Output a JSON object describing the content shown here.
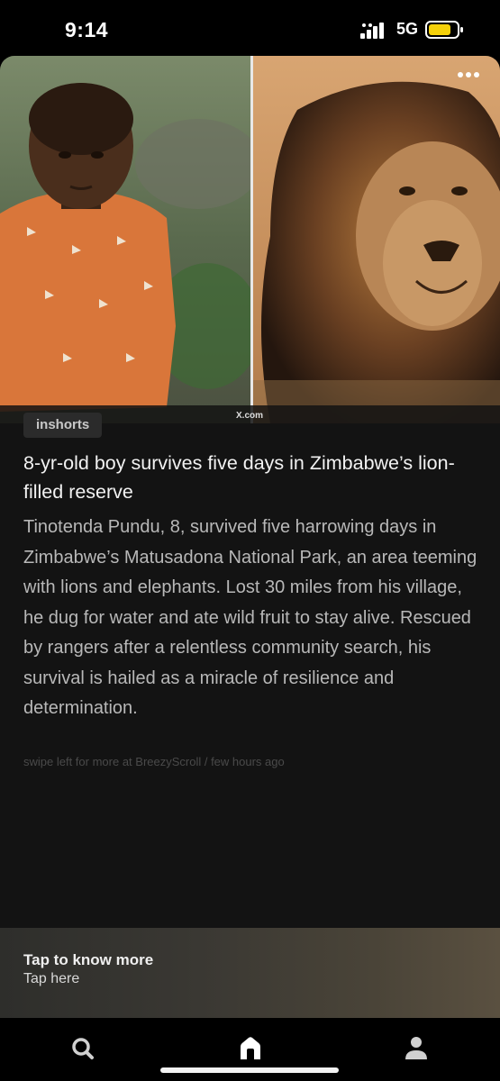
{
  "status_bar": {
    "time": "9:14",
    "network": "5G",
    "signal_icon": "signal-bars-icon",
    "battery_icon": "battery-low-icon",
    "battery_color": "#f5d10a"
  },
  "article": {
    "image_watermark": "X.com",
    "image_description_icons": [
      "boy-photo",
      "lion-photo"
    ],
    "source": "inshorts",
    "headline": "8-yr-old boy survives five days in Zimbabwe’s lion-filled reserve",
    "summary": "Tinotenda Pundu, 8, survived five harrowing days in Zimbabwe’s Matusadona National Park, an area teeming with lions and elephants. Lost 30 miles from his village, he dug for water and ate wild fruit to stay alive. Rescued by rangers after a relentless community search, his survival is hailed as a miracle of resilience and determination.",
    "meta": "swipe left for more at BreezyScroll / few hours ago"
  },
  "cta": {
    "title": "Tap to know more",
    "subtitle": "Tap here"
  },
  "nav": {
    "items": [
      "search-icon",
      "home-icon",
      "profile-icon"
    ],
    "active": "home-icon"
  },
  "colors": {
    "background": "#000000",
    "card": "#131313",
    "headline": "#f2f2f2",
    "summary": "#b8b8b8"
  }
}
